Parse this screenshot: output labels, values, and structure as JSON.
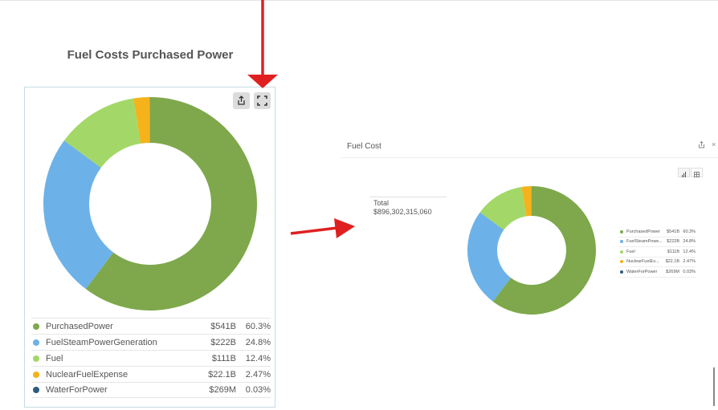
{
  "left": {
    "title": "Fuel Costs Purchased Power",
    "toolbar": {
      "share_icon": "share-icon",
      "expand_icon": "fullscreen-icon"
    }
  },
  "right": {
    "panel_title": "Fuel Cost",
    "total_label": "Total",
    "total_value": "$896,302,315,060",
    "close_glyph": "×"
  },
  "chart_data": [
    {
      "type": "pie",
      "donut": true,
      "title": "Fuel Costs Purchased Power",
      "slices": [
        {
          "name": "PurchasedPower",
          "value_label": "$541B",
          "percent": 60.3,
          "percent_label": "60.3%",
          "color": "#7ea84b"
        },
        {
          "name": "FuelSteamPowerGeneration",
          "value_label": "$222B",
          "percent": 24.8,
          "percent_label": "24.8%",
          "color": "#6cb2e8"
        },
        {
          "name": "Fuel",
          "value_label": "$111B",
          "percent": 12.4,
          "percent_label": "12.4%",
          "color": "#a3d868"
        },
        {
          "name": "NuclearFuelExpense",
          "value_label": "$22.1B",
          "percent": 2.47,
          "percent_label": "2.47%",
          "color": "#f5b21b"
        },
        {
          "name": "WaterForPower",
          "value_label": "$269M",
          "percent": 0.03,
          "percent_label": "0.03%",
          "color": "#2d5c7e"
        }
      ],
      "legend": "bottom"
    },
    {
      "type": "pie",
      "donut": true,
      "title": "Fuel Cost",
      "slices": [
        {
          "name": "PurchasedPower",
          "value_label": "$541B",
          "percent": 60.3,
          "percent_label": "60.3%",
          "color": "#7ea84b"
        },
        {
          "name": "FuelSteamPowe...",
          "value_label": "$222B",
          "percent": 24.8,
          "percent_label": "24.8%",
          "color": "#6cb2e8"
        },
        {
          "name": "Fuel",
          "value_label": "$111B",
          "percent": 12.4,
          "percent_label": "12.4%",
          "color": "#a3d868"
        },
        {
          "name": "NuclearFuelEx...",
          "value_label": "$22.1B",
          "percent": 2.47,
          "percent_label": "2.47%",
          "color": "#f5b21b"
        },
        {
          "name": "WaterForPower",
          "value_label": "$269M",
          "percent": 0.03,
          "percent_label": "0.03%",
          "color": "#2d5c7e"
        }
      ],
      "legend": "right"
    }
  ],
  "annotations": {
    "arrow_color": "#e02020"
  }
}
